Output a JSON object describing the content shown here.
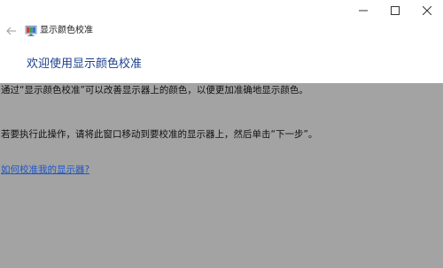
{
  "window": {
    "controls": {
      "minimize_icon": "minimize-icon",
      "maximize_icon": "maximize-icon",
      "close_icon": "close-icon"
    }
  },
  "nav": {
    "back_icon": "back-arrow-icon",
    "app_icon": "display-color-calibration-icon",
    "title": "显示颜色校准"
  },
  "main": {
    "heading": "欢迎使用显示颜色校准",
    "paragraph1": "通过“显示颜色校准”可以改善显示器上的颜色，以便更加准确地显示颜色。",
    "paragraph2": "若要执行此操作，请将此窗口移动到要校准的显示器上，然后单击“下一步”。",
    "help_link": "如何校准我的显示器?"
  },
  "colors": {
    "heading": "#1b3f8f",
    "link": "#1d56c9",
    "content_background": "#a3a3a3"
  }
}
